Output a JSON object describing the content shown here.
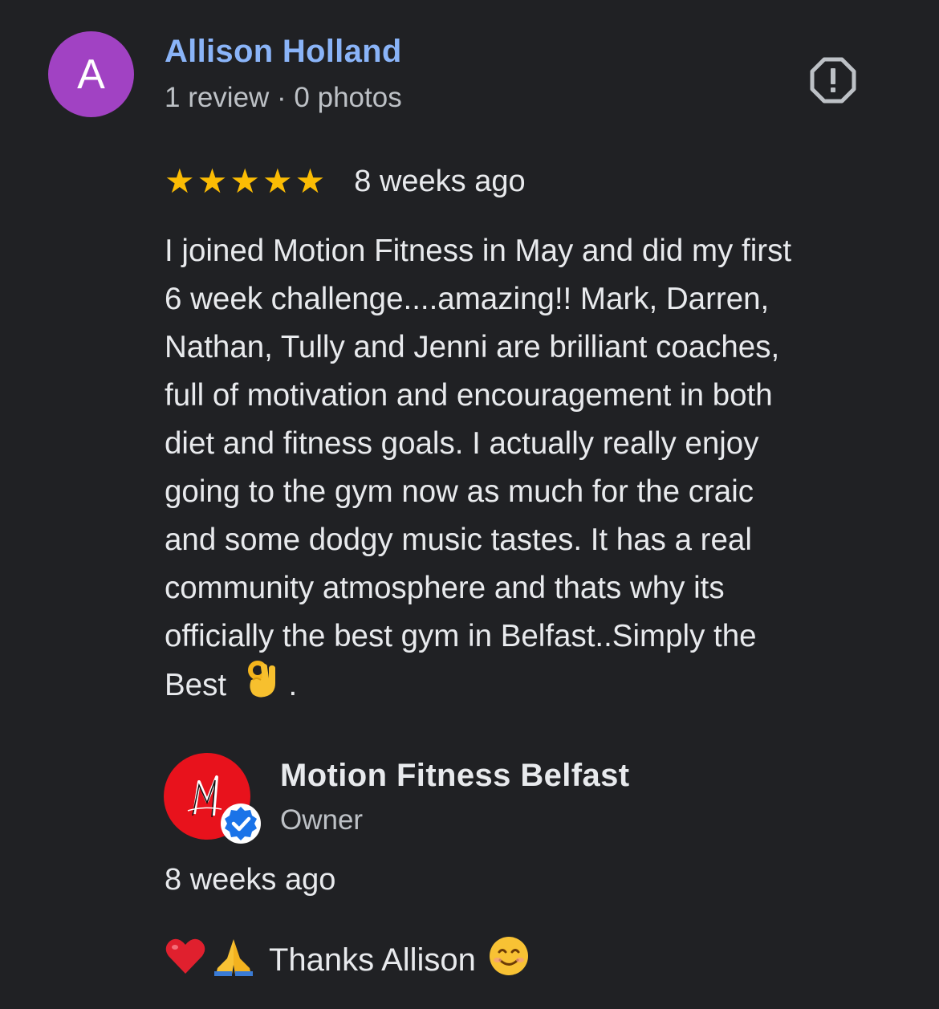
{
  "review": {
    "avatar_letter": "A",
    "author_name": "Allison Holland",
    "author_meta": "1 review · 0 photos",
    "rating": 5,
    "rating_max": 5,
    "time_ago": "8 weeks ago",
    "text_lines": [
      "I joined Motion Fitness in May and did my first",
      "6 week challenge....amazing!! Mark, Darren,",
      "Nathan, Tully and Jenni are brilliant coaches,",
      "full of motivation and encouragement in both",
      "diet and fitness goals. I actually really enjoy",
      "going to the gym now as much for the craic",
      "and some dodgy music tastes. It has a real",
      "community atmosphere and thats why its",
      "officially the best gym in Belfast..Simply the"
    ],
    "text_last_line": "Best",
    "text_last_suffix": ".",
    "text_emoji": "ok-hand-emoji"
  },
  "owner_response": {
    "name": "Motion Fitness Belfast",
    "role": "Owner",
    "time_ago": "8 weeks ago",
    "reply_text": "Thanks Allison",
    "reply_emojis_before": [
      "red-heart-emoji",
      "folded-hands-emoji"
    ],
    "reply_emoji_after": "smiling-face-emoji"
  },
  "colors": {
    "background": "#202124",
    "author_link": "#8ab4f8",
    "avatar": "#a142c3",
    "star": "#fbbc04",
    "owner_logo": "#e8121c",
    "verified_badge": "#1a73e8"
  },
  "icons": {
    "report": "report-flag-icon",
    "verified": "verified-check-icon"
  }
}
